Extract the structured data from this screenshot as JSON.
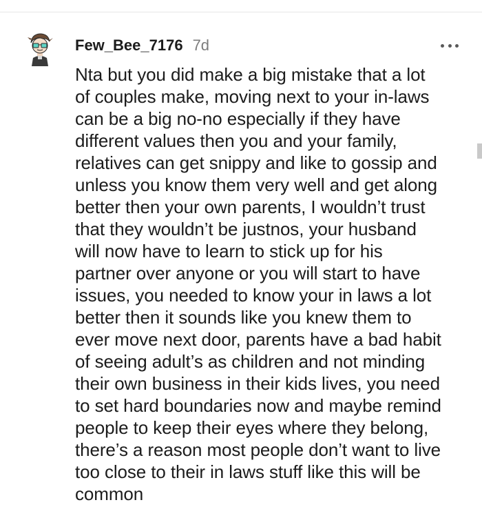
{
  "comment": {
    "username": "Few_Bee_7176",
    "age": "7d",
    "more_label": "•••",
    "body": "Nta but you did make a big mistake that a lot\nof couples make, moving next to your in-laws\ncan be a big no-no especially if they have\ndifferent values then you and your family,\nrelatives can get snippy and like to gossip and\nunless you know them very well and get along\nbetter then your own parents, I wouldn’t trust\nthat they wouldn’t be justnos, your husband\nwill now have to learn to stick up for his\npartner over anyone or you will start to have\nissues, you needed to know your in laws a lot\nbetter then it sounds like you knew them to\never move next door, parents have a bad habit\nof seeing adult’s as children and not minding\ntheir own business in their kids lives, you need\nto set hard boundaries now and maybe remind\npeople to keep their eyes where they belong,\nthere’s a reason most people don’t want to live\ntoo close to their in laws stuff like this will be\ncommon"
  },
  "colors": {
    "text": "#1c1c1c",
    "muted": "#7c7c7c",
    "divider": "#e6e6e6"
  }
}
